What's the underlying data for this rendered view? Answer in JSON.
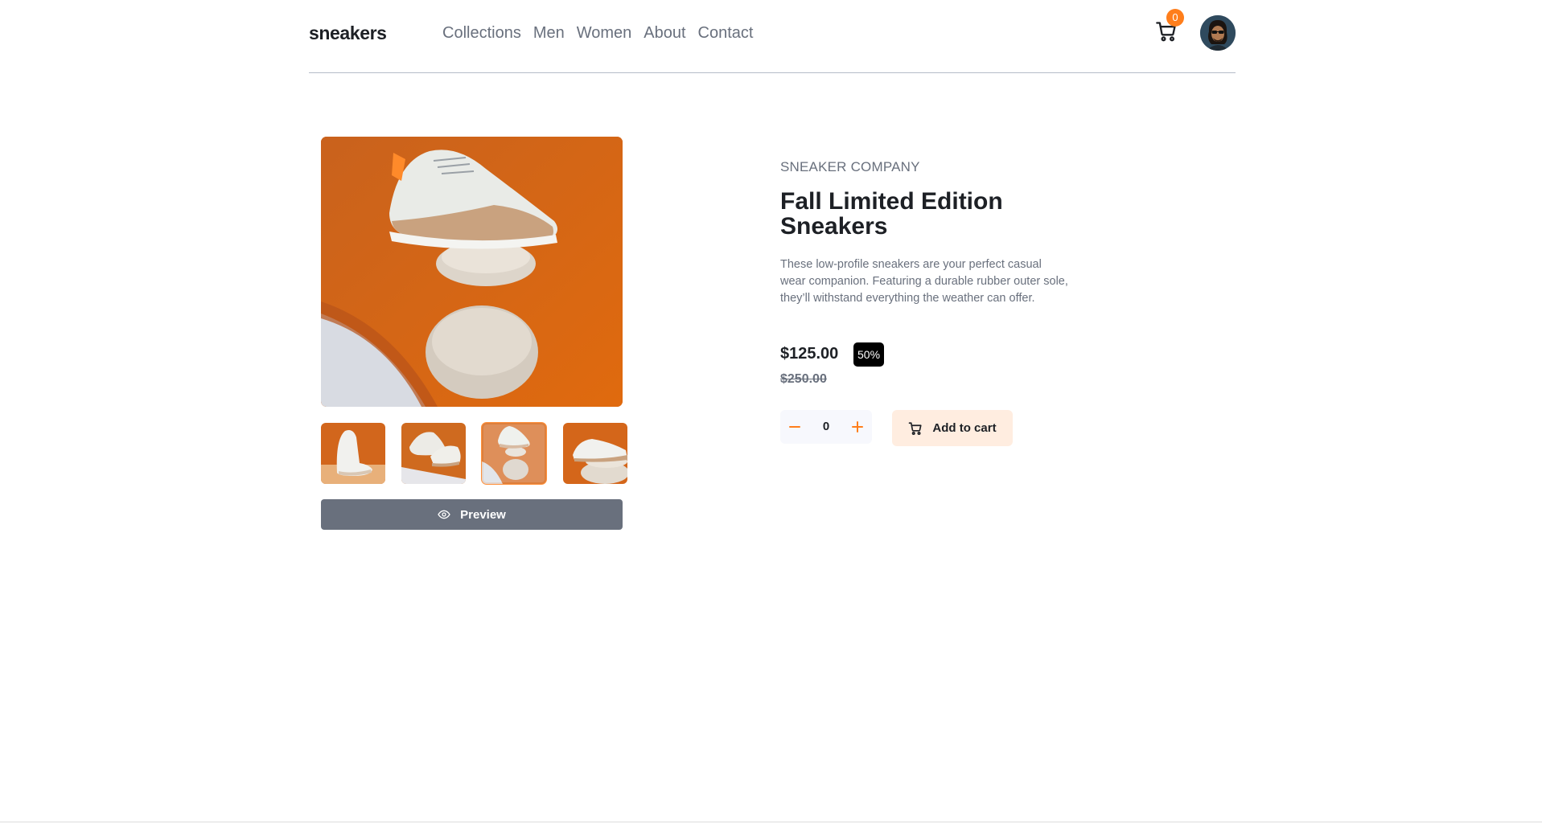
{
  "header": {
    "logo": "sneakers",
    "nav": [
      "Collections",
      "Men",
      "Women",
      "About",
      "Contact"
    ],
    "cart": {
      "count": "0",
      "icon": "cart-icon"
    },
    "avatar": {
      "icon": "avatar"
    }
  },
  "gallery": {
    "selected_thumbnail": 3,
    "thumbnail_count": 4,
    "preview_label": "Preview",
    "preview_icon": "eye-icon"
  },
  "product": {
    "company": "SNEAKER COMPANY",
    "title": "Fall Limited Edition Sneakers",
    "description": "These low-profile sneakers are your perfect casual wear companion. Featuring a durable rubber outer sole, they’ll withstand everything the weather can offer.",
    "price": "$125.00",
    "discount": "50%",
    "old_price": "$250.00",
    "quantity": "0",
    "add_to_cart_label": "Add to cart"
  },
  "colors": {
    "accent": "#ff7e1b",
    "accent_pale": "#ffede0",
    "text_dark": "#1d2025",
    "text_muted": "#69707d",
    "preview_button": "#69707d"
  }
}
